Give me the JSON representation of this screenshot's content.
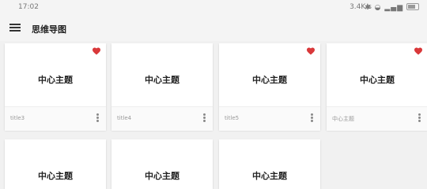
{
  "status_bar": {
    "time": "17:02",
    "network_speed": "3.4K/s",
    "icons": [
      "bluetooth-icon",
      "nfc-icon",
      "wifi-icon",
      "signal-icon",
      "signal-icon",
      "wifi-icon",
      "battery-icon"
    ]
  },
  "app_bar": {
    "title": "思维导图",
    "menu_icon": "menu-icon"
  },
  "cards": [
    {
      "center": "中心主题",
      "label": "title3",
      "favorite": true
    },
    {
      "center": "中心主题",
      "label": "title4",
      "favorite": false
    },
    {
      "center": "中心主题",
      "label": "title5",
      "favorite": true
    },
    {
      "center": "中心主题",
      "label": "中心主题",
      "favorite": true
    },
    {
      "center": "中心主题",
      "label": "",
      "favorite": false
    },
    {
      "center": "中心主题",
      "label": "",
      "favorite": false
    },
    {
      "center": "中心主题",
      "label": "",
      "favorite": false
    }
  ],
  "colors": {
    "heart": "#d9383a",
    "background": "#f1f1f1",
    "card": "#ffffff"
  }
}
